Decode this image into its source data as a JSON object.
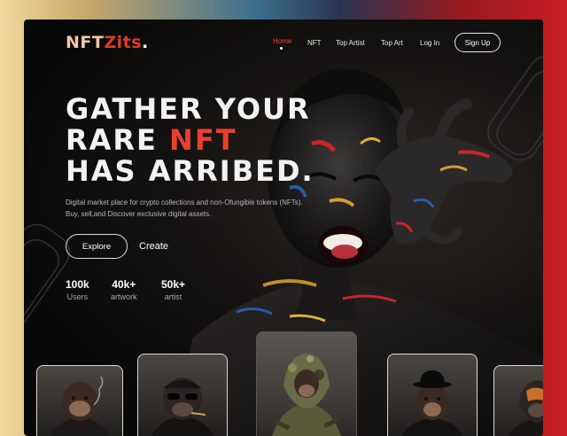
{
  "brand": {
    "logo_part1": "NFT",
    "logo_part2": "Zits",
    "logo_dot": "."
  },
  "nav": {
    "items": [
      {
        "label": "Home",
        "active": true
      },
      {
        "label": "NFT",
        "active": false
      },
      {
        "label": "Top Artist",
        "active": false
      },
      {
        "label": "Top Art",
        "active": false
      },
      {
        "label": "Log In",
        "active": false
      }
    ],
    "signup_label": "Sign Up"
  },
  "hero": {
    "headline_line1": "GATHER YOUR",
    "headline_line2_pre": "RARE ",
    "headline_line2_accent": "NFT",
    "headline_line3": "HAS ARRIBED.",
    "description": "Digital market place for crypto collections and non-Ofungible tokens (NFTs). Buy, sell,and Discover exclusive digital assets.",
    "explore_label": "Explore",
    "create_label": "Create"
  },
  "stats": [
    {
      "value": "100k",
      "label": "Users"
    },
    {
      "value": "40k+",
      "label": "artwork"
    },
    {
      "value": "50k+",
      "label": "artist"
    }
  ],
  "cards": [
    {
      "name": "ape-smoking-hoodie"
    },
    {
      "name": "ape-sunglasses-cigar"
    },
    {
      "name": "ape-camo-hood"
    },
    {
      "name": "ape-bowler-hat"
    },
    {
      "name": "ape-red-hood"
    }
  ],
  "colors": {
    "accent": "#e8402e",
    "background": "#0a0909",
    "text": "#f2f2f2"
  }
}
